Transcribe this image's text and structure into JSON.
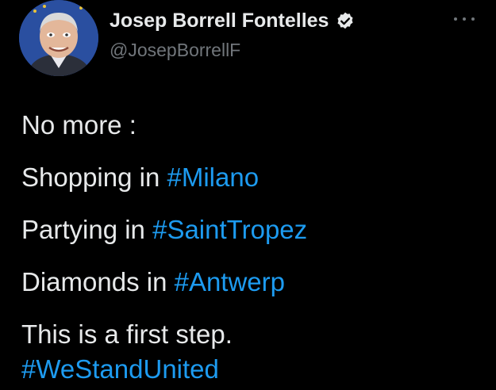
{
  "author": {
    "display_name": "Josep Borrell Fontelles",
    "handle": "@JosepBorrellF",
    "verified_icon": "verified-badge-icon",
    "avatar_icon": "profile-photo"
  },
  "menu": {
    "icon": "more-options-icon"
  },
  "tweet": {
    "line1": "No more :",
    "line2_text": "Shopping in ",
    "line2_tag": "#Milano",
    "line3_text": "Partying in ",
    "line3_tag": "#SaintTropez",
    "line4_text": "Diamonds in ",
    "line4_tag": "#Antwerp",
    "line5": "This is a first step.",
    "line6_tag": "#WeStandUnited"
  },
  "colors": {
    "background": "#000000",
    "text": "#e7e9ea",
    "secondary": "#71767b",
    "link": "#1d9bf0"
  }
}
